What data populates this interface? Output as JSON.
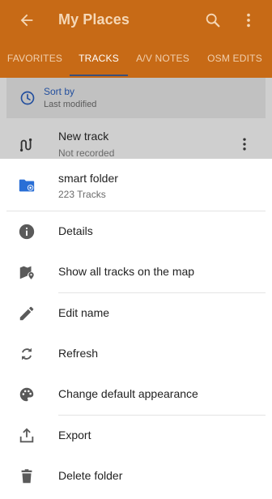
{
  "header": {
    "title": "My Places"
  },
  "tabs": [
    {
      "label": "FAVORITES"
    },
    {
      "label": "TRACKS"
    },
    {
      "label": "A/V NOTES"
    },
    {
      "label": "OSM EDITS"
    }
  ],
  "sort": {
    "title": "Sort by",
    "value": "Last modified"
  },
  "track": {
    "name": "New track",
    "status": "Not recorded"
  },
  "sheet": {
    "folder_name": "smart folder",
    "folder_count": "223 Tracks",
    "items": [
      {
        "label": "Details",
        "icon": "info-icon"
      },
      {
        "label": "Show all tracks on the map",
        "icon": "map-icon"
      },
      {
        "label": "Edit name",
        "icon": "pencil-icon"
      },
      {
        "label": "Refresh",
        "icon": "refresh-icon"
      },
      {
        "label": "Change default appearance",
        "icon": "palette-icon"
      },
      {
        "label": "Export",
        "icon": "export-icon"
      },
      {
        "label": "Delete folder",
        "icon": "trash-icon"
      }
    ]
  },
  "colors": {
    "appbar": "#c76a16",
    "accent": "#234f9e",
    "indicator": "#3b4f7a"
  }
}
